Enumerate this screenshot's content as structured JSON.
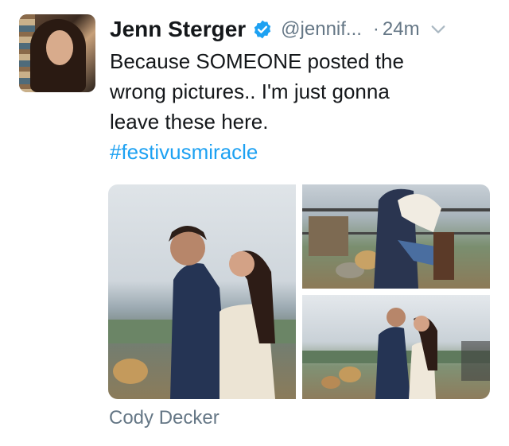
{
  "tweet": {
    "author_name": "Jenn Sterger",
    "handle": "@jennif...",
    "time_separator": "·",
    "time": "24m",
    "text_lines": [
      "Because SOMEONE posted the",
      "wrong pictures.. I'm just gonna",
      "leave these here."
    ],
    "hashtag": "#festivusmiracle",
    "media_caption": "Cody Decker",
    "icons": {
      "verified": "verified-badge-icon",
      "more": "chevron-down-icon"
    },
    "colors": {
      "name": "#14171a",
      "meta": "#657786",
      "hashtag": "#1da1f2",
      "verified": "#1da1f2"
    }
  }
}
